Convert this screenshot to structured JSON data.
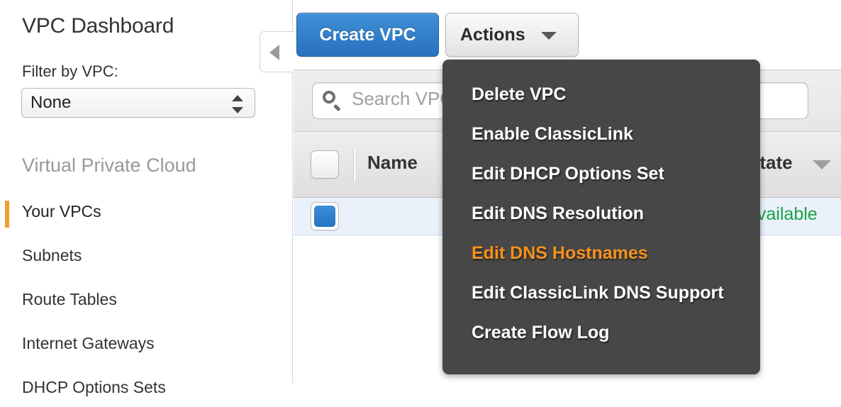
{
  "sidebar": {
    "title": "VPC Dashboard",
    "filter": {
      "label": "Filter by VPC:",
      "value": "None",
      "stepper_icon": "stepper-updown-icon"
    },
    "section_heading": "Virtual Private Cloud",
    "items": [
      {
        "label": "Your VPCs",
        "active": true
      },
      {
        "label": "Subnets",
        "active": false
      },
      {
        "label": "Route Tables",
        "active": false
      },
      {
        "label": "Internet Gateways",
        "active": false
      },
      {
        "label": "DHCP Options Sets",
        "active": false
      }
    ],
    "accent_color": "#F59C2B"
  },
  "collapse": {
    "icon": "triangle-left-icon"
  },
  "toolbar": {
    "create_label": "Create VPC",
    "actions_label": "Actions",
    "actions_caret_icon": "chevron-down-icon",
    "primary_color": "#2a71bd"
  },
  "search": {
    "icon": "search-icon",
    "placeholder": "Search VPCs and their properties",
    "value": ""
  },
  "table": {
    "columns": [
      {
        "label": "Name",
        "sortable": false
      },
      {
        "label": "State",
        "sortable": true
      }
    ],
    "sort_icon": "sort-descending-arrow-icon",
    "rows": [
      {
        "selected": true,
        "name": "",
        "state": "available",
        "state_color": "#1aa245"
      }
    ]
  },
  "menu": {
    "open": true,
    "highlight_color": "#F5921E",
    "background_color": "#474747",
    "items": [
      {
        "label": "Delete VPC",
        "highlighted": false
      },
      {
        "label": "Enable ClassicLink",
        "highlighted": false
      },
      {
        "label": "Edit DHCP Options Set",
        "highlighted": false
      },
      {
        "label": "Edit DNS Resolution",
        "highlighted": false
      },
      {
        "label": "Edit DNS Hostnames",
        "highlighted": true
      },
      {
        "label": "Edit ClassicLink DNS Support",
        "highlighted": false
      },
      {
        "label": "Create Flow Log",
        "highlighted": false
      }
    ]
  }
}
